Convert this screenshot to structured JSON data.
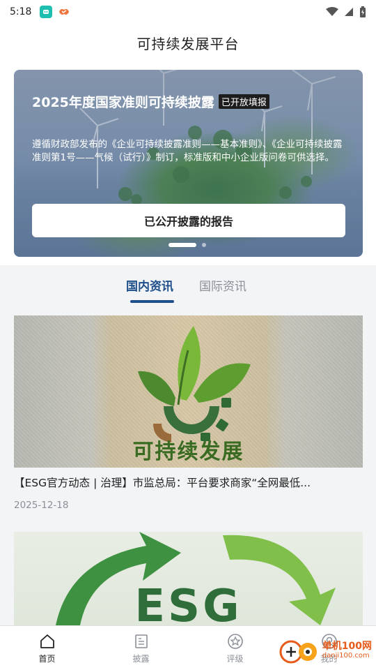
{
  "status_bar": {
    "time": "5:18"
  },
  "header": {
    "title": "可持续发展平台"
  },
  "banner": {
    "title": "2025年度国家准则可持续披露",
    "badge": "已开放填报",
    "description": "遵循财政部发布的《企业可持续披露准则——基本准则》、《企业可持续披露准则第1号——气候（试行）》制订，标准版和中小企业版问卷可供选择。",
    "button_label": "已公开披露的报告",
    "carousel": {
      "count": 2,
      "active": 1
    }
  },
  "tabs": [
    {
      "label": "国内资讯",
      "active": true
    },
    {
      "label": "国际资讯",
      "active": false
    }
  ],
  "news": [
    {
      "title": "【ESG官方动态 | 治理】市监总局：平台要求商家“全网最低...",
      "date": "2025-12-18",
      "image_text": "可持续发展"
    },
    {
      "title": "",
      "date": "",
      "image_text": "ESG"
    }
  ],
  "bottom_nav": [
    {
      "label": "首页",
      "icon": "home-icon",
      "active": true
    },
    {
      "label": "披露",
      "icon": "document-icon",
      "active": false
    },
    {
      "label": "评级",
      "icon": "star-badge-icon",
      "active": false
    },
    {
      "label": "我的",
      "icon": "user-icon",
      "active": false
    }
  ],
  "watermark": {
    "brand": "单机100网",
    "url": "danji100.com"
  },
  "colors": {
    "accent": "#1f4f8a",
    "muted": "#8a8f97",
    "watermark": "#e65a1a"
  }
}
